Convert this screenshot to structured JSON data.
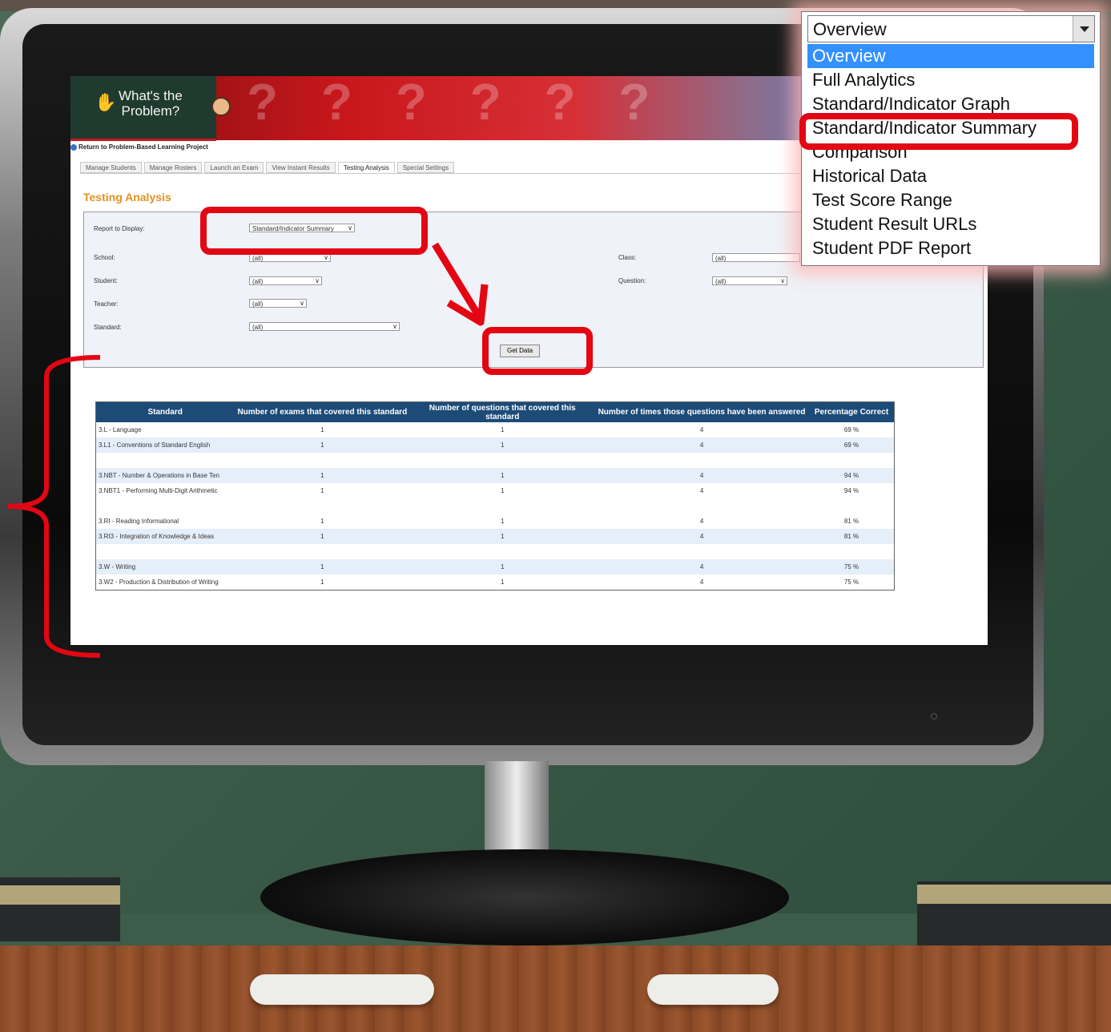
{
  "app": {
    "logo_text_line1": "What's the",
    "logo_text_line2": "Problem?",
    "return_link": "Return to Problem-Based Learning Project"
  },
  "tabs": [
    {
      "label": "Manage Students",
      "active": false
    },
    {
      "label": "Manage Rosters",
      "active": false
    },
    {
      "label": "Launch an Exam",
      "active": false
    },
    {
      "label": "View Instant Results",
      "active": false
    },
    {
      "label": "Testing Analysis",
      "active": true
    },
    {
      "label": "Special Settings",
      "active": false
    }
  ],
  "page_title": "Testing Analysis",
  "filters": {
    "report_label": "Report to Display:",
    "report_value": "Standard/Indicator Summary",
    "school_label": "School:",
    "school_value": "(all)",
    "student_label": "Student:",
    "student_value": "(all)",
    "teacher_label": "Teacher:",
    "teacher_value": "(all)",
    "standard_label": "Standard:",
    "standard_value": "(all)",
    "class_label": "Class:",
    "class_value": "(all)",
    "question_label": "Question:",
    "question_value": "(all)",
    "get_data_label": "Get Data"
  },
  "table": {
    "headers": [
      "Standard",
      "Number of exams that covered this standard",
      "Number of questions that covered this standard",
      "Number of times those questions have been answered",
      "Percentage Correct"
    ],
    "rows": [
      {
        "standard": "3.L - Language",
        "exams": "1",
        "questions": "1",
        "answered": "4",
        "pct": "69 %"
      },
      {
        "standard": "3.L1 - Conventions of Standard English",
        "exams": "1",
        "questions": "1",
        "answered": "4",
        "pct": "69 %"
      },
      {
        "blank": true
      },
      {
        "standard": "3.NBT - Number & Operations in Base Ten",
        "exams": "1",
        "questions": "1",
        "answered": "4",
        "pct": "94 %"
      },
      {
        "standard": "3.NBT1 - Performing Multi-Digit Arithmetic",
        "exams": "1",
        "questions": "1",
        "answered": "4",
        "pct": "94 %"
      },
      {
        "blank": true
      },
      {
        "standard": "3.RI - Reading Informational",
        "exams": "1",
        "questions": "1",
        "answered": "4",
        "pct": "81 %"
      },
      {
        "standard": "3.RI3 - Integration of Knowledge & Ideas",
        "exams": "1",
        "questions": "1",
        "answered": "4",
        "pct": "81 %"
      },
      {
        "blank": true
      },
      {
        "standard": "3.W - Writing",
        "exams": "1",
        "questions": "1",
        "answered": "4",
        "pct": "75 %"
      },
      {
        "standard": "3.W2 - Production & Distribution of Writing",
        "exams": "1",
        "questions": "1",
        "answered": "4",
        "pct": "75 %"
      }
    ]
  },
  "dropdown": {
    "current": "Overview",
    "options": [
      {
        "label": "Overview",
        "highlighted": true
      },
      {
        "label": "Full Analytics",
        "highlighted": false
      },
      {
        "label": "Standard/Indicator Graph",
        "highlighted": false
      },
      {
        "label": "Standard/Indicator Summary",
        "highlighted": false
      },
      {
        "label": "Comparison",
        "highlighted": false
      },
      {
        "label": "Historical Data",
        "highlighted": false
      },
      {
        "label": "Test Score Range",
        "highlighted": false
      },
      {
        "label": "Student Result URLs",
        "highlighted": false
      },
      {
        "label": "Student PDF Report",
        "highlighted": false
      }
    ]
  },
  "colors": {
    "annotation": "#e30613",
    "accent_heading": "#e2911d",
    "table_header": "#1c4b78",
    "highlight": "#3390ff"
  }
}
